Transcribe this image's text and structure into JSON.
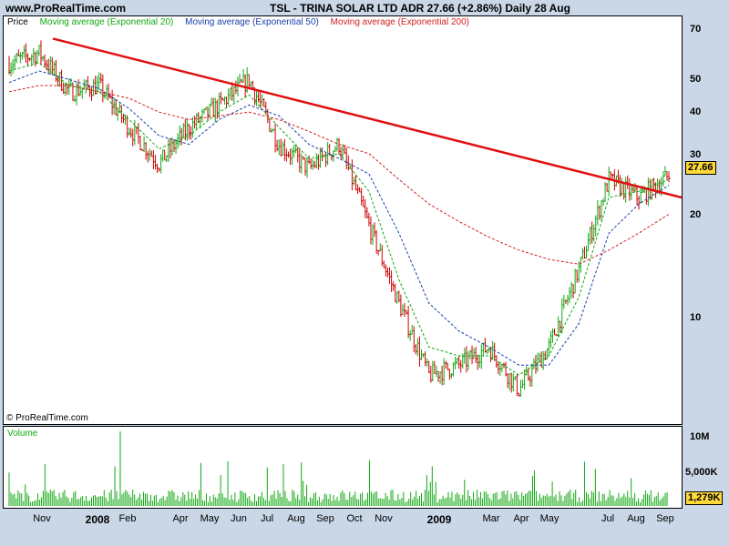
{
  "header": {
    "site": "www.ProRealTime.com",
    "quote": "TSL - TRINA SOLAR LTD ADR    27.66 (+2.86%)    Daily  28 Aug"
  },
  "legend": {
    "price": "Price",
    "ma20": "Moving average (Exponential 20)",
    "ma50": "Moving average (Exponential 50)",
    "ma200": "Moving average (Exponential 200)"
  },
  "copyright": "© ProRealTime.com",
  "volume_label": "Volume",
  "last_price_label": "27.66",
  "last_volume_label": "1,279K",
  "colors": {
    "up": "#11a811",
    "down": "#cc0000",
    "ma20": "#11a811",
    "ma50": "#1a3faa",
    "ma200": "#d42020",
    "trendline": "#e01010",
    "badge": "#ffd83a",
    "volume": "#11a811"
  },
  "chart_data": [
    {
      "type": "line",
      "title": "TSL - TRINA SOLAR LTD ADR",
      "scale": "log",
      "y_ticks": [
        "70",
        "50",
        "40",
        "30",
        "20",
        "10"
      ],
      "ylim": [
        5.5,
        75
      ],
      "x_ticks": [
        "Nov",
        "2008",
        "Feb",
        "Apr",
        "May",
        "Jun",
        "Jul",
        "Aug",
        "Sep",
        "Oct",
        "Nov",
        "2009",
        "Mar",
        "Apr",
        "May",
        "Jul",
        "Aug",
        "Sep"
      ],
      "series": [
        {
          "name": "Price",
          "x": [
            "Oct 2007",
            "Nov 2007",
            "Dec 2007",
            "Jan 2008",
            "Feb 2008",
            "Mar 2008",
            "Apr 2008",
            "May 2008",
            "Jun 2008",
            "Jul 2008",
            "Aug 2008",
            "Sep 2008",
            "Oct 2008",
            "Nov 2008",
            "Dec 2008",
            "Jan 2009",
            "Feb 2009",
            "Mar 2009",
            "Apr 2009",
            "May 2009",
            "Jun 2009",
            "Jul 2009",
            "Aug 2009"
          ],
          "values": [
            58,
            62,
            48,
            50,
            38,
            30,
            38,
            44,
            52,
            34,
            29,
            34,
            20,
            12,
            7.5,
            8,
            9,
            6.8,
            9,
            15,
            27,
            24,
            27.66
          ]
        },
        {
          "name": "Moving average (Exponential 20)",
          "values": [
            55,
            58,
            50,
            48,
            40,
            33,
            36,
            42,
            47,
            38,
            31,
            32,
            25,
            14,
            9,
            8.5,
            8.5,
            7.5,
            8.5,
            12.5,
            24,
            25,
            27
          ]
        },
        {
          "name": "Moving average (Exponential 50)",
          "values": [
            51,
            55,
            52,
            49,
            43,
            36,
            34,
            40,
            44,
            41,
            34,
            31,
            28,
            19,
            12,
            10,
            9,
            8,
            8,
            10.5,
            19,
            23,
            26
          ]
        },
        {
          "name": "Moving average (Exponential 200)",
          "values": [
            48,
            50,
            50,
            48,
            46,
            42,
            40,
            41,
            42,
            40,
            37,
            34,
            32,
            27,
            23,
            20.5,
            18.5,
            17,
            16,
            15.5,
            17,
            19,
            21.5
          ]
        }
      ],
      "trendline": {
        "from": [
          "Nov 2007",
          68
        ],
        "to": [
          "Sep 2009",
          24
        ]
      }
    },
    {
      "type": "bar",
      "title": "Volume",
      "y_ticks": [
        "10M",
        "5,000K"
      ],
      "last_value": "1,279K"
    }
  ]
}
